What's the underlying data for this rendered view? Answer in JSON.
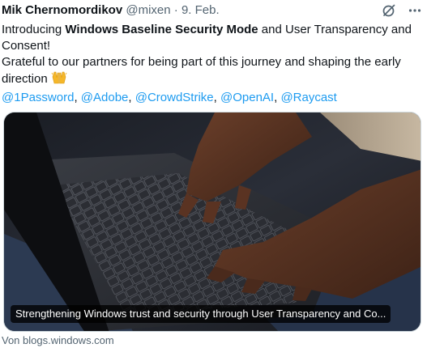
{
  "tweet": {
    "author_name": "Mik Chernomordikov",
    "handle": "@mixen",
    "separator": "·",
    "date": "9. Feb.",
    "line1_prefix": "Introducing ",
    "line1_bold": "Windows Baseline Security Mode",
    "line1_suffix": " and User Transparency and Consent!",
    "line2": "Grateful to our partners for being part of this journey and shaping the early direction",
    "emoji": "raising-hands-emoji",
    "mentions": [
      "@1Password",
      "@Adobe",
      "@CrowdStrike",
      "@OpenAI",
      "@Raycast"
    ],
    "mention_separator": ", "
  },
  "media": {
    "image": "photo of hands typing on a laptop keyboard",
    "caption": "Strengthening Windows trust and security through User Transparency and Co..."
  },
  "source": {
    "label": "Von blogs.windows.com"
  },
  "icons": {
    "grok": "grok-icon",
    "more": "more-options-icon"
  },
  "colors": {
    "text": "#0f1419",
    "secondary": "#536471",
    "link": "#1d9bf0"
  }
}
